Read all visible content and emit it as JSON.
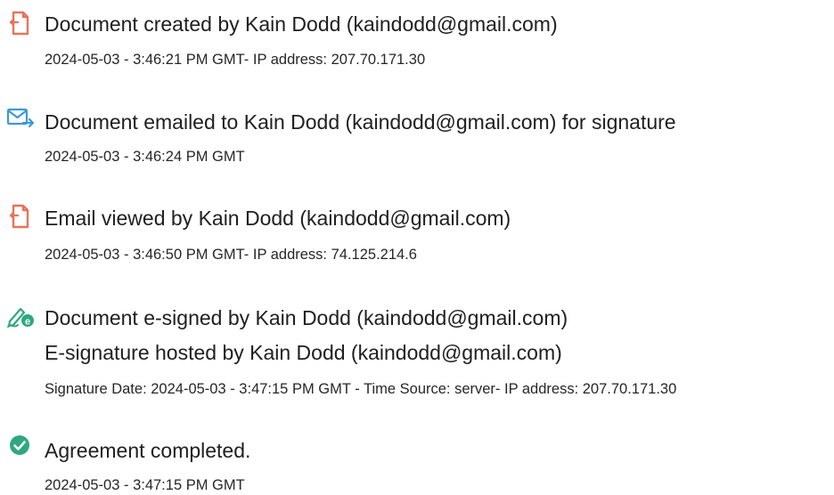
{
  "events": [
    {
      "icon": "document-created-icon",
      "title": "Document created by Kain Dodd (kaindodd@gmail.com)",
      "detail": "2024-05-03 - 3:46:21 PM GMT- IP address: 207.70.171.30"
    },
    {
      "icon": "email-sent-icon",
      "title": "Document emailed to Kain Dodd (kaindodd@gmail.com) for signature",
      "detail": "2024-05-03 - 3:46:24 PM GMT"
    },
    {
      "icon": "document-viewed-icon",
      "title": "Email viewed by Kain Dodd (kaindodd@gmail.com)",
      "detail": "2024-05-03 - 3:46:50 PM GMT- IP address: 74.125.214.6"
    },
    {
      "icon": "e-sign-pen-icon",
      "title": "Document e-signed by Kain Dodd (kaindodd@gmail.com)",
      "title2": "E-signature hosted by Kain Dodd (kaindodd@gmail.com)",
      "detail": "Signature Date: 2024-05-03 - 3:47:15 PM GMT - Time Source: server- IP address: 207.70.171.30"
    },
    {
      "icon": "checkmark-circle-icon",
      "title": "Agreement completed.",
      "detail": "2024-05-03 - 3:47:15 PM GMT"
    }
  ],
  "colors": {
    "doc_icon": "#e8735a",
    "email_icon": "#3c9ad6",
    "sign_icon": "#2fa880",
    "check_icon": "#2fa880"
  }
}
